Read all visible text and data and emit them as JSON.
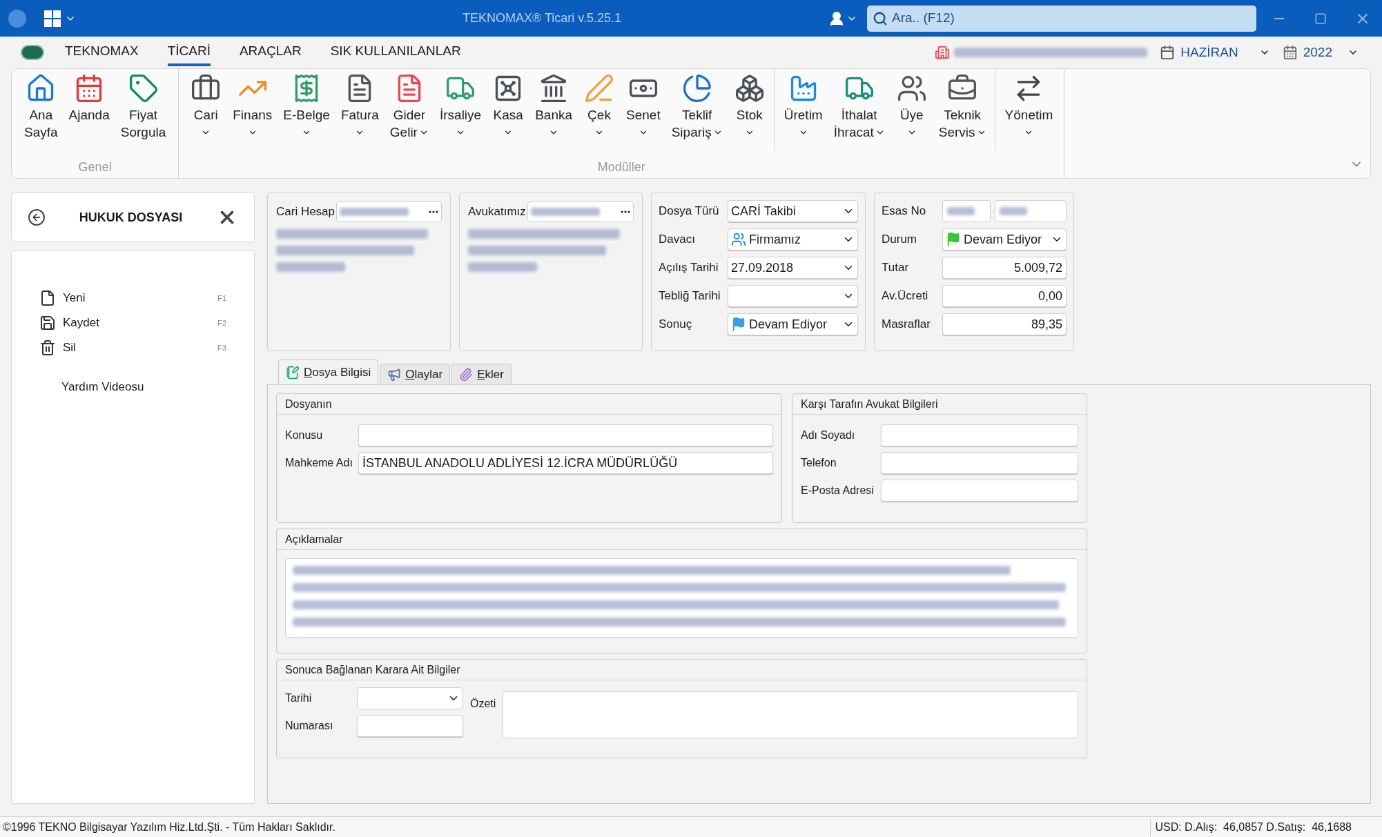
{
  "title_bar": {
    "title": "TEKNOMAX® Ticari v.5.25.1",
    "search_placeholder": "Ara.. (F12)"
  },
  "menu_tabs": [
    {
      "label": "TEKNOMAX",
      "selected": false
    },
    {
      "label": "TİCARİ",
      "selected": true
    },
    {
      "label": "ARAÇLAR",
      "selected": false
    },
    {
      "label": "SIK KULLANILANLAR",
      "selected": false
    }
  ],
  "period": {
    "month": "HAZİRAN",
    "year": "2022"
  },
  "ribbon": {
    "groups": [
      {
        "label": "Genel",
        "sections": [
          [
            {
              "lines": [
                "Ana",
                "Sayfa"
              ],
              "dropdown": false
            },
            {
              "lines": [
                "Ajanda"
              ],
              "dropdown": false
            },
            {
              "lines": [
                "Fiyat",
                "Sorgula"
              ],
              "dropdown": false
            }
          ]
        ]
      },
      {
        "label": "Modüller",
        "sections": [
          [
            {
              "lines": [
                "Cari"
              ],
              "dropdown": true
            },
            {
              "lines": [
                "Finans"
              ],
              "dropdown": true
            },
            {
              "lines": [
                "E-Belge"
              ],
              "dropdown": true
            },
            {
              "lines": [
                "Fatura"
              ],
              "dropdown": true
            },
            {
              "lines": [
                "Gider",
                "Gelir"
              ],
              "dropdown": true
            },
            {
              "lines": [
                "İrsaliye"
              ],
              "dropdown": true
            },
            {
              "lines": [
                "Kasa"
              ],
              "dropdown": true
            },
            {
              "lines": [
                "Banka"
              ],
              "dropdown": true
            },
            {
              "lines": [
                "Çek"
              ],
              "dropdown": true
            },
            {
              "lines": [
                "Senet"
              ],
              "dropdown": true
            },
            {
              "lines": [
                "Teklif",
                "Sipariş"
              ],
              "dropdown": true
            },
            {
              "lines": [
                "Stok"
              ],
              "dropdown": true
            }
          ],
          [
            {
              "lines": [
                "Üretim"
              ],
              "dropdown": true
            },
            {
              "lines": [
                "İthalat",
                "İhracat"
              ],
              "dropdown": true
            },
            {
              "lines": [
                "Üye"
              ],
              "dropdown": true
            },
            {
              "lines": [
                "Teknik",
                "Servis"
              ],
              "dropdown": true
            }
          ],
          [
            {
              "lines": [
                "Yönetim"
              ],
              "dropdown": true
            }
          ]
        ]
      }
    ]
  },
  "side_panel": {
    "title": "HUKUK DOSYASI",
    "actions": [
      {
        "label": "Yeni",
        "shortcut": "F1"
      },
      {
        "label": "Kaydet",
        "shortcut": "F2"
      },
      {
        "label": "Sil",
        "shortcut": "F3"
      }
    ],
    "help": "Yardım Videosu"
  },
  "cari_card": {
    "label": "Cari Hesap"
  },
  "avukat_card": {
    "label": "Avukatımız"
  },
  "file_fields": [
    {
      "label": "Dosya Türü",
      "value": "CARİ Takibi",
      "kind": "select"
    },
    {
      "label": "Davacı",
      "value": "Firmamız",
      "kind": "people-select"
    },
    {
      "label": "Açılış Tarihi",
      "value": "27.09.2018",
      "kind": "select"
    },
    {
      "label": "Tebliğ Tarihi",
      "kind": "select"
    },
    {
      "label": "Sonuç",
      "value": "Devam Ediyor",
      "kind": "flag-select",
      "color": "#3b9ee0"
    }
  ],
  "case_fields": [
    {
      "label": "Esas No",
      "kind": "redacted-pair"
    },
    {
      "label": "Durum",
      "value": "Devam Ediyor",
      "kind": "flag-select",
      "color": "#3cc43c"
    },
    {
      "label": "Tutar",
      "value": "5.009,72",
      "kind": "number"
    },
    {
      "label": "Av.Ücreti",
      "value": "0,00",
      "kind": "number"
    },
    {
      "label": "Masraflar",
      "value": "89,35",
      "kind": "number"
    }
  ],
  "tabs": [
    {
      "label": "Dosya Bilgisi",
      "selected": true
    },
    {
      "label": "Olaylar",
      "selected": false
    },
    {
      "label": "Ekler",
      "selected": false
    }
  ],
  "dosya": {
    "title": "Dosyanın",
    "fields": [
      {
        "label": "Konusu"
      },
      {
        "label": "Mahkeme Adı",
        "value": "İSTANBUL ANADOLU ADLİYESİ  12.İCRA MÜDÜRLÜĞÜ"
      }
    ]
  },
  "karsi": {
    "title": "Karşı Tarafın Avukat Bilgileri",
    "fields": [
      {
        "label": "Adı Soyadı"
      },
      {
        "label": "Telefon"
      },
      {
        "label": "E-Posta Adresi"
      }
    ]
  },
  "aciklamalar": {
    "title": "Açıklamalar"
  },
  "karar": {
    "title": "Sonuca Bağlanan Karara Ait Bilgiler",
    "date_label": "Tarihi",
    "number_label": "Numarası",
    "summary_label": "Özeti"
  },
  "status_bar": {
    "copyright": "©1996 TEKNO Bilgisayar Yazılım Hiz.Ltd.Şti. - Tüm Hakları Saklıdır.",
    "currency": "USD: D.Alış:  46,0857 D.Satış:  46,1688"
  }
}
